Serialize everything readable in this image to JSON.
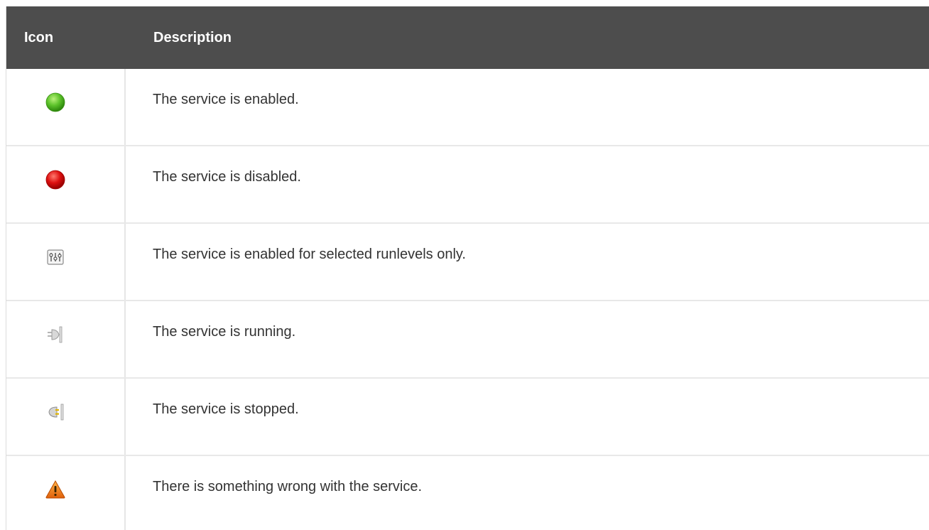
{
  "header": {
    "icon_label": "Icon",
    "description_label": "Description"
  },
  "rows": [
    {
      "icon": "green-circle-icon",
      "color": "#4caf1f",
      "description": "The service is enabled."
    },
    {
      "icon": "red-circle-icon",
      "color": "#d40000",
      "description": "The service is disabled."
    },
    {
      "icon": "runlevels-icon",
      "description": "The service is enabled for selected runlevels only."
    },
    {
      "icon": "plug-connected-icon",
      "description": "The service is running."
    },
    {
      "icon": "plug-disconnected-icon",
      "description": "The service is stopped."
    },
    {
      "icon": "warning-triangle-icon",
      "color": "#f07a0a",
      "description": "There is something wrong with the service."
    }
  ]
}
